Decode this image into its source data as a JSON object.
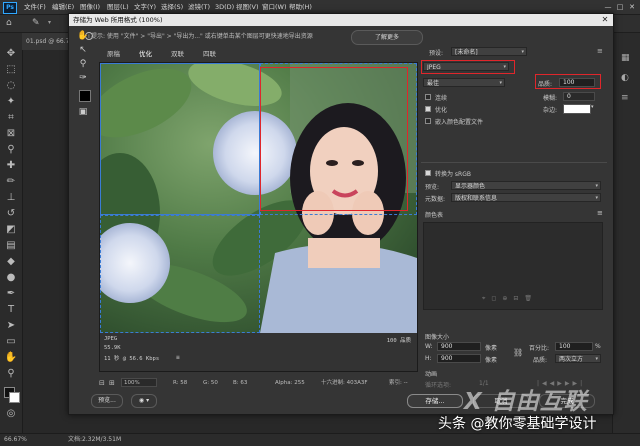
{
  "menubar": {
    "logo": "Ps",
    "items": [
      "文件(F)",
      "编辑(E)",
      "图像(I)",
      "图层(L)",
      "文字(Y)",
      "选择(S)",
      "滤镜(T)",
      "3D(D)",
      "视图(V)",
      "窗口(W)",
      "帮助(H)"
    ]
  },
  "window_controls": [
    "—",
    "□",
    "✕"
  ],
  "doc_tab": "01.psd @ 66.7",
  "status": {
    "zoom": "66.67%",
    "doc": "文档:2.32M/3.51M"
  },
  "dialog": {
    "title": "存储为 Web 所用格式 (100%)",
    "hint": "提示: 使用 \"文件\" > \"导出\" > \"导出为...\" 或右键单击某个图层可更快速地导出资源",
    "learn_more": "了解更多",
    "tabs": [
      "原稿",
      "优化",
      "双联",
      "四联"
    ],
    "preview_info": {
      "format": "JPEG",
      "size": "55.9K",
      "time": "11 秒 @ 56.6 Kbps",
      "quality": "100 品质"
    },
    "bottom": {
      "zoom": "100%",
      "r": "R: 58",
      "g": "G: 50",
      "b": "B: 63",
      "alpha": "Alpha: 255",
      "hex": "十六进制: 403A3F",
      "index": "索引: --"
    },
    "buttons": {
      "preview": "预览...",
      "save": "存储...",
      "cancel": "取消",
      "done": "完成"
    }
  },
  "settings": {
    "preset_label": "预设:",
    "preset_value": "[未命名]",
    "format": "JPEG",
    "compression": "最佳",
    "quality_label": "品质:",
    "quality_value": "100",
    "progressive_label": "连续",
    "progressive_checked": false,
    "optimized_label": "优化",
    "optimized_checked": true,
    "embed_profile_label": "嵌入颜色配置文件",
    "embed_profile_checked": false,
    "blur_label": "模糊:",
    "blur_value": "0",
    "matte_label": "杂边:",
    "convert_srgb_label": "转换为 sRGB",
    "convert_srgb_checked": true,
    "preview_label": "预览:",
    "preview_value": "显示器颜色",
    "metadata_label": "元数据:",
    "metadata_value": "版权和联系信息",
    "color_table_label": "颜色表",
    "image_size_label": "图像大小",
    "w_label": "W:",
    "w_value": "900",
    "h_label": "H:",
    "h_value": "900",
    "unit": "像素",
    "percent_label": "百分比:",
    "percent_value": "100",
    "percent_unit": "%",
    "quality_resample_label": "品质:",
    "quality_resample_value": "两次立方",
    "animation_label": "动画",
    "loop_label": "循环选项:",
    "frame": "1/1"
  },
  "watermark": {
    "logo": "X 自由互联",
    "text": "头条 @教你零基础学设计"
  },
  "colors": {
    "highlight": "#e0262b",
    "accent": "#31a8ff"
  }
}
